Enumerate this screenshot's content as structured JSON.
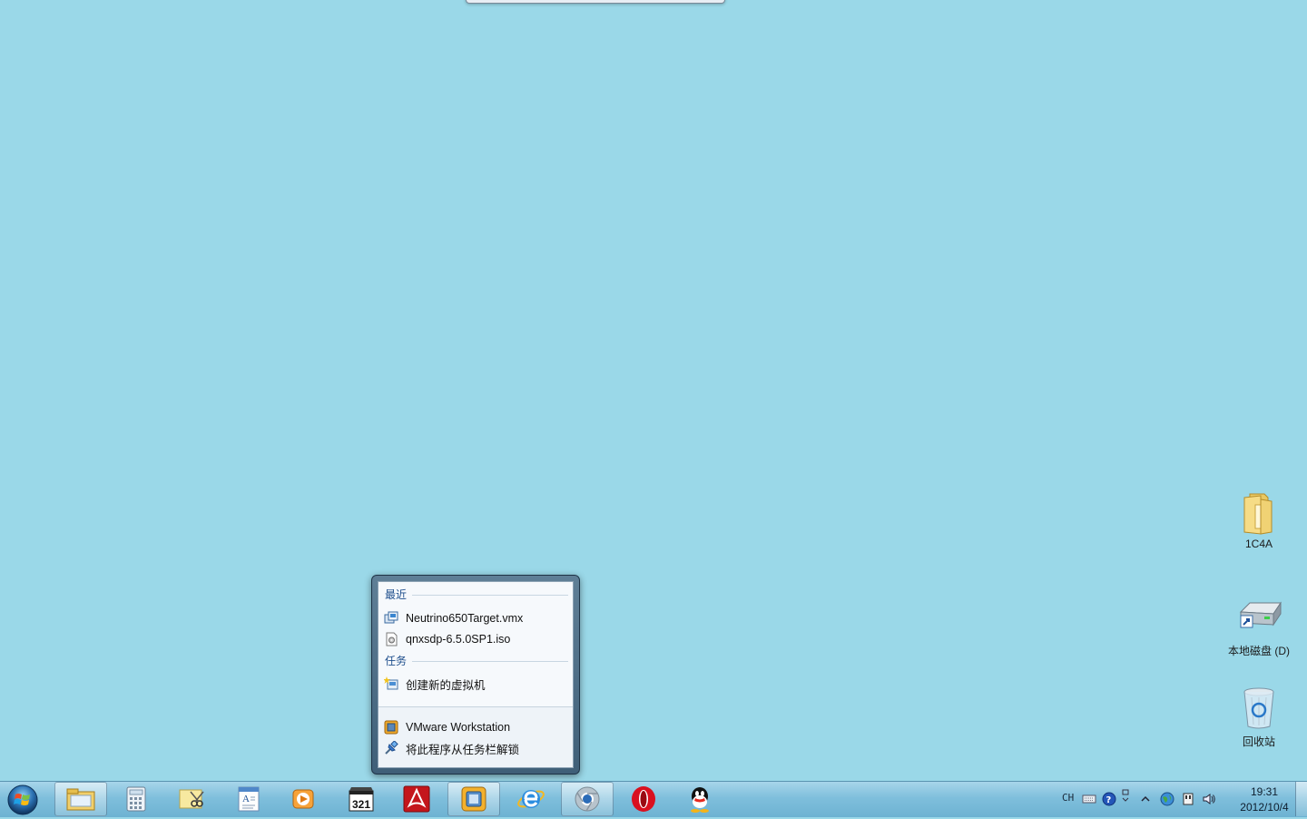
{
  "desktop": {
    "icons": [
      {
        "label": "1C4A"
      },
      {
        "label": "本地磁盘 (D)"
      },
      {
        "label": "回收站"
      }
    ]
  },
  "jumplist": {
    "recent_header": "最近",
    "recent_items": [
      {
        "label": "Neutrino650Target.vmx"
      },
      {
        "label": "qnxsdp-6.5.0SP1.iso"
      }
    ],
    "tasks_header": "任务",
    "task_items": [
      {
        "label": "创建新的虚拟机"
      }
    ],
    "app_label": "VMware Workstation",
    "unpin_label": "将此程序从任务栏解锁"
  },
  "taskbar": {
    "pinned": [
      {
        "icon": "windows-explorer-icon",
        "active": true
      },
      {
        "icon": "calculator-icon"
      },
      {
        "icon": "snipping-tool-icon"
      },
      {
        "icon": "wordpad-icon"
      },
      {
        "icon": "media-player-icon"
      },
      {
        "icon": "media-player-classic-icon"
      },
      {
        "icon": "adobe-reader-icon"
      },
      {
        "icon": "vmware-workstation-icon",
        "active": true
      },
      {
        "icon": "internet-explorer-icon"
      },
      {
        "icon": "chrome-icon",
        "active": true
      },
      {
        "icon": "opera-icon"
      },
      {
        "icon": "qq-icon"
      }
    ],
    "tray": {
      "language": "CH",
      "time": "19:31",
      "date": "2012/10/4"
    }
  },
  "colors": {
    "desktop_bg": "#9ad8e8",
    "taskbar": "#7fbfdc",
    "jumplist_header": "#1e4e8c"
  }
}
